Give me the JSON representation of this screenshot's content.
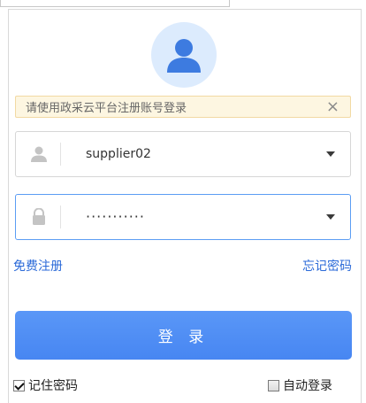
{
  "notice": {
    "text": "请使用政采云平台注册账号登录",
    "close_glyph": "×"
  },
  "username": {
    "value": "supplier02"
  },
  "password": {
    "value": "···········"
  },
  "links": {
    "register": "免费注册",
    "forgot": "忘记密码"
  },
  "login_button": {
    "label": "登 录"
  },
  "remember_me": {
    "label": "记住密码",
    "checked": true
  },
  "auto_login": {
    "label": "自动登录",
    "checked": false
  },
  "colors": {
    "accent": "#4a8af4",
    "link": "#2b6ad8",
    "notice_bg": "#fdf6e1"
  }
}
